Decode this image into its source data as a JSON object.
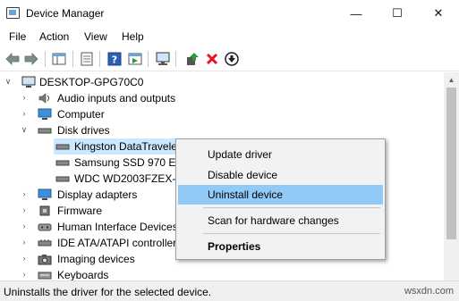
{
  "window": {
    "title": "Device Manager",
    "minimize_glyph": "—",
    "maximize_glyph": "☐",
    "close_glyph": "✕"
  },
  "menu": [
    "File",
    "Action",
    "View",
    "Help"
  ],
  "toolbar": {
    "icons": [
      "back-arrow-icon",
      "forward-arrow-icon",
      "show-hide-console-tree-icon",
      "properties-icon",
      "help-icon",
      "action-pane-icon",
      "scan-hardware-icon",
      "update-driver-icon",
      "uninstall-device-icon",
      "disable-device-icon"
    ]
  },
  "tree": {
    "root": "DESKTOP-GPG70C0",
    "items": [
      {
        "label": "Audio inputs and outputs",
        "expanded": false,
        "icon": "speaker-icon"
      },
      {
        "label": "Computer",
        "expanded": false,
        "icon": "computer-icon"
      },
      {
        "label": "Disk drives",
        "expanded": true,
        "icon": "disk-drive-icon"
      },
      {
        "label": "Kingston DataTraveler",
        "child": true,
        "selected": true,
        "icon": "drive-icon"
      },
      {
        "label": "Samsung SSD 970 EVO",
        "child": true,
        "icon": "drive-icon"
      },
      {
        "label": "WDC WD2003FZEX-00",
        "child": true,
        "icon": "drive-icon"
      },
      {
        "label": "Display adapters",
        "expanded": false,
        "icon": "monitor-icon"
      },
      {
        "label": "Firmware",
        "expanded": false,
        "icon": "firmware-icon"
      },
      {
        "label": "Human Interface Devices",
        "expanded": false,
        "icon": "hid-icon"
      },
      {
        "label": "IDE ATA/ATAPI controllers",
        "expanded": false,
        "icon": "controller-icon"
      },
      {
        "label": "Imaging devices",
        "expanded": false,
        "icon": "camera-icon"
      },
      {
        "label": "Keyboards",
        "expanded": false,
        "icon": "keyboard-icon"
      }
    ]
  },
  "context_menu": {
    "items": [
      {
        "label": "Update driver"
      },
      {
        "label": "Disable device"
      },
      {
        "label": "Uninstall device",
        "highlighted": true
      },
      {
        "label": "Scan for hardware changes"
      },
      {
        "label": "Properties",
        "bold": true
      }
    ]
  },
  "status": {
    "text": "Uninstalls the driver for the selected device.",
    "watermark": "wsxdn.com"
  },
  "colors": {
    "selection": "#cce8ff",
    "menu_highlight": "#91c9f7",
    "uninstall_red": "#e81123",
    "update_green": "#2e9b3a"
  }
}
